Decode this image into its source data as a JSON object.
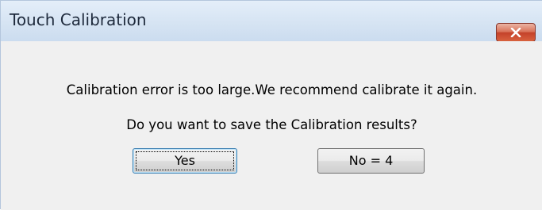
{
  "window": {
    "title": "Touch Calibration",
    "close_icon": "close-icon"
  },
  "dialog": {
    "message_line_1": "Calibration error is too large.We recommend calibrate it again.",
    "message_line_2": "Do you want to save the Calibration results?"
  },
  "buttons": {
    "yes_label": "Yes",
    "no_label": "No = 4"
  },
  "colors": {
    "close_button": "#c4422a",
    "titlebar": "#d6e4f3",
    "dialog_background": "#f0f0f0",
    "default_button_border": "#3c7fb1"
  }
}
